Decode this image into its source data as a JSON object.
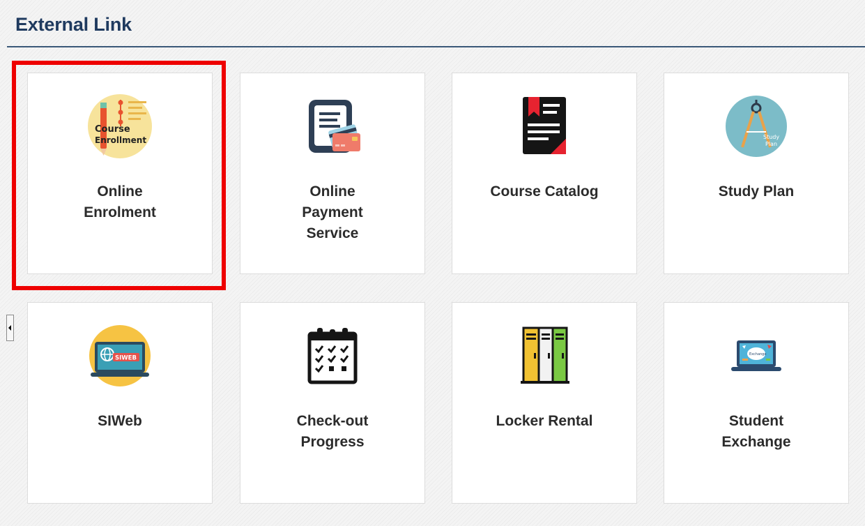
{
  "section": {
    "title": "External Link"
  },
  "tiles": [
    {
      "icon": "course-enrollment-icon",
      "icon_text": "Course Enrollment",
      "label_lines": [
        "Online",
        "Enrolment"
      ],
      "highlighted": true
    },
    {
      "icon": "payment-card-icon",
      "label_lines": [
        "Online",
        "Payment",
        "Service"
      ]
    },
    {
      "icon": "catalog-book-icon",
      "label_lines": [
        "Course Catalog"
      ]
    },
    {
      "icon": "study-plan-compass-icon",
      "icon_text": "Study Plan",
      "label_lines": [
        "Study Plan"
      ]
    },
    {
      "icon": "siweb-laptop-icon",
      "icon_text": "SIWEB",
      "label_lines": [
        "SIWeb"
      ]
    },
    {
      "icon": "checklist-calendar-icon",
      "label_lines": [
        "Check-out",
        "Progress"
      ]
    },
    {
      "icon": "locker-icon",
      "label_lines": [
        "Locker Rental"
      ]
    },
    {
      "icon": "exchange-laptop-icon",
      "icon_text": "Exchange",
      "label_lines": [
        "Student",
        "Exchange"
      ]
    }
  ],
  "colors": {
    "title": "#1f3a5f",
    "highlight_border": "#ee0000",
    "tile_label": "#2b2b2b"
  }
}
